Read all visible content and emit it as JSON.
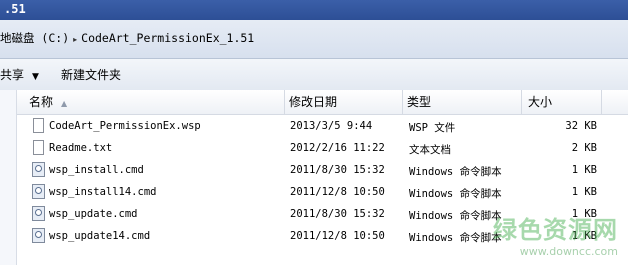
{
  "window": {
    "title": ".51"
  },
  "address": {
    "segments": [
      "地磁盘 (C:)",
      "CodeArt_PermissionEx_1.51"
    ],
    "separator_icon": "chevron-right-icon"
  },
  "toolbar": {
    "share_label": "共享",
    "share_caret": "▼",
    "new_folder_label": "新建文件夹"
  },
  "columns": {
    "name": "名称",
    "date": "修改日期",
    "type": "类型",
    "size": "大小",
    "sort_indicator": "▲"
  },
  "files": [
    {
      "icon": "document-icon",
      "name": "CodeArt_PermissionEx.wsp",
      "date": "2013/3/5 9:44",
      "type": "WSP 文件",
      "size": "32 KB"
    },
    {
      "icon": "document-icon",
      "name": "Readme.txt",
      "date": "2012/2/16 11:22",
      "type": "文本文档",
      "size": "2 KB"
    },
    {
      "icon": "batch-file-icon",
      "name": "wsp_install.cmd",
      "date": "2011/8/30 15:32",
      "type": "Windows 命令脚本",
      "size": "1 KB"
    },
    {
      "icon": "batch-file-icon",
      "name": "wsp_install14.cmd",
      "date": "2011/12/8 10:50",
      "type": "Windows 命令脚本",
      "size": "1 KB"
    },
    {
      "icon": "batch-file-icon",
      "name": "wsp_update.cmd",
      "date": "2011/8/30 15:32",
      "type": "Windows 命令脚本",
      "size": "1 KB"
    },
    {
      "icon": "batch-file-icon",
      "name": "wsp_update14.cmd",
      "date": "2011/12/8 10:50",
      "type": "Windows 命令脚本",
      "size": "1 KB"
    }
  ],
  "watermark": {
    "text": "绿色资源网",
    "url": "www.downcc.com"
  }
}
